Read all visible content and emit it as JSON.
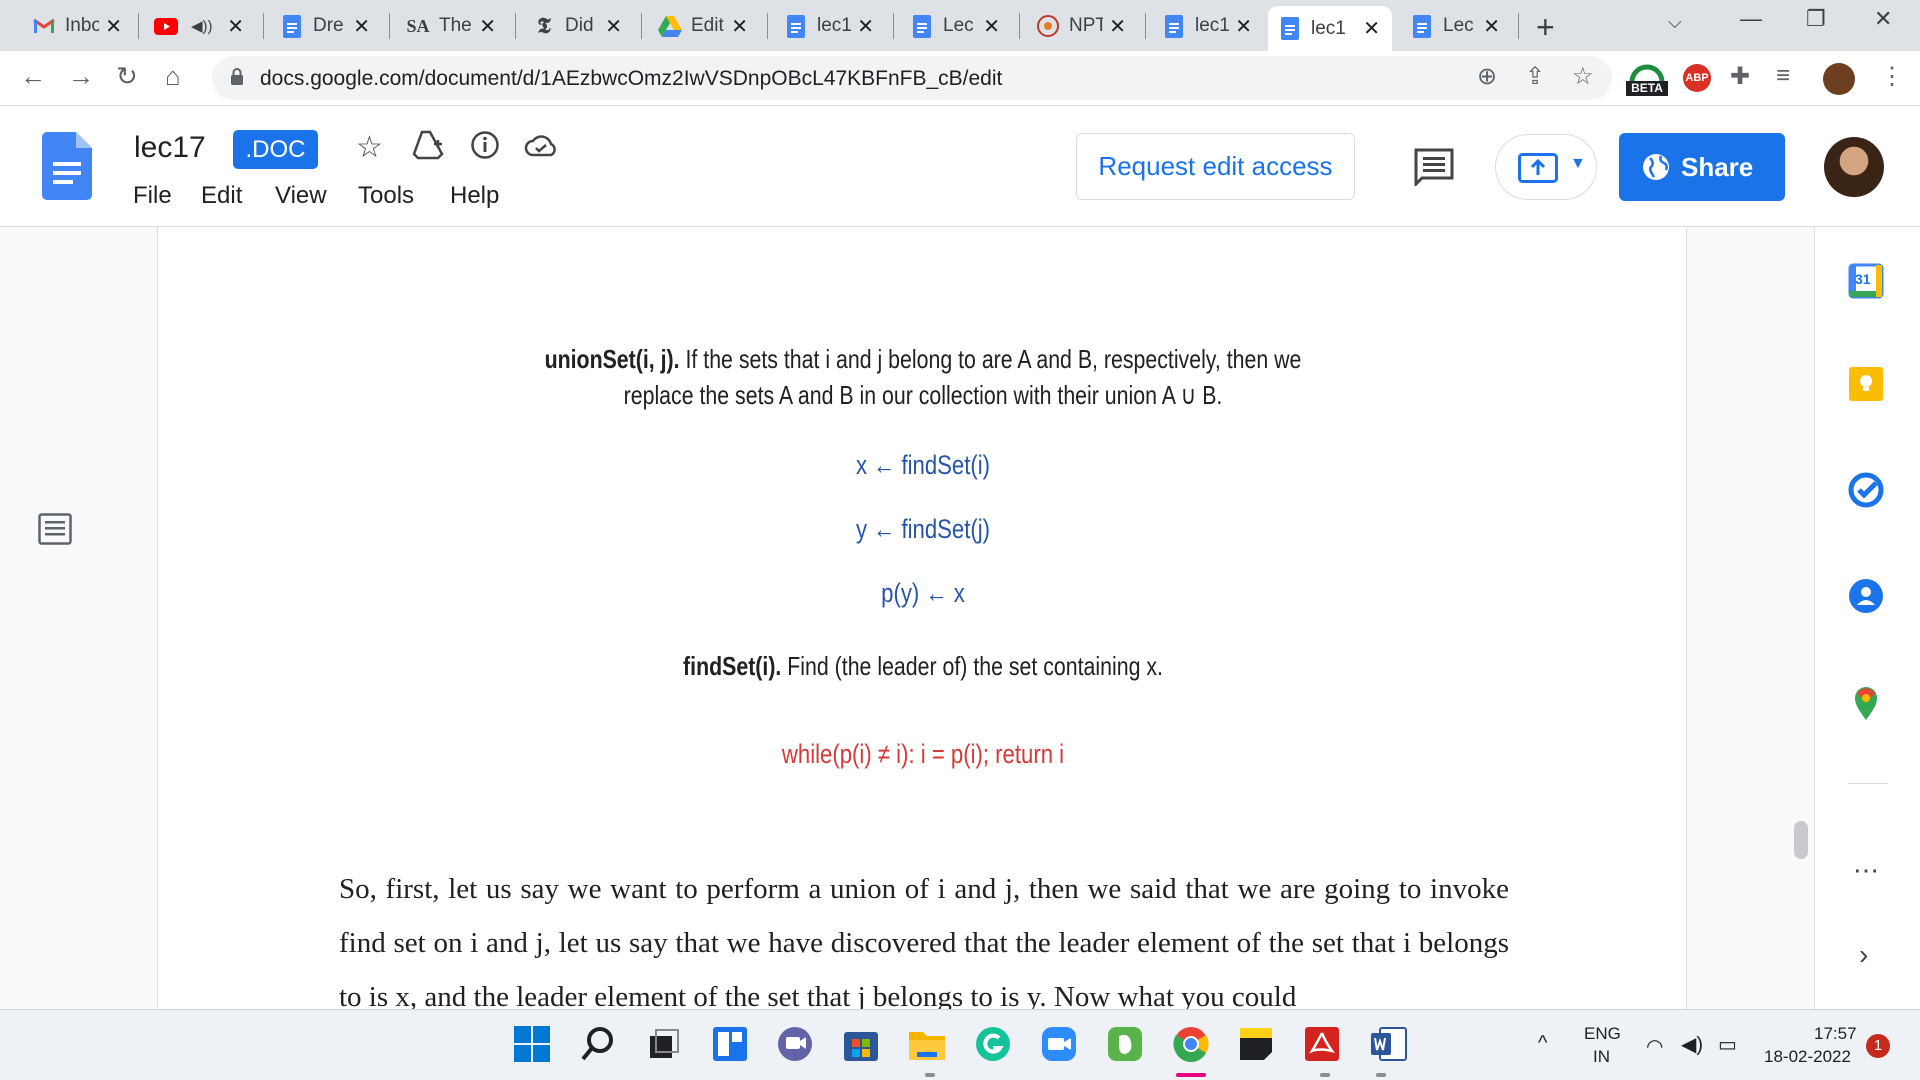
{
  "browser": {
    "tabs": [
      {
        "label": "Inbo",
        "icon": "gmail-icon",
        "active": false
      },
      {
        "label": "",
        "icon": "youtube-icon",
        "audio": true,
        "active": false
      },
      {
        "label": "Dre",
        "icon": "docs-icon",
        "active": false
      },
      {
        "label": "The",
        "icon": "sa-icon",
        "active": false
      },
      {
        "label": "Did",
        "icon": "nyt-icon",
        "active": false
      },
      {
        "label": "Edit",
        "icon": "drive-icon",
        "active": false
      },
      {
        "label": "lec1",
        "icon": "docs-icon",
        "active": false
      },
      {
        "label": "Lec",
        "icon": "docs-icon",
        "active": false
      },
      {
        "label": "NPT",
        "icon": "nptel-icon",
        "active": false
      },
      {
        "label": "lec1",
        "icon": "docs-icon",
        "active": false
      },
      {
        "label": "lec1",
        "icon": "docs-icon",
        "active": true
      },
      {
        "label": "Lec",
        "icon": "docs-icon",
        "active": false
      }
    ],
    "url": "docs.google.com/document/d/1AEzbwcOmz2IwVSDnpOBcL47KBFnFB_cB/edit",
    "beta_badge": "BETA",
    "abp_badge": "ABP"
  },
  "docs": {
    "title": "lec17",
    "badge": ".DOC",
    "menu": [
      "File",
      "Edit",
      "View",
      "Tools",
      "Help"
    ],
    "request_edit_label": "Request edit access",
    "share_label": "Share"
  },
  "content": {
    "union_bold": "unionSet(i, j).",
    "union_text_1": " If the sets that i and j belong to are A and B, respectively, then we",
    "union_text_2": "replace the sets A and B in our collection with their union A ∪ B.",
    "code_1": "x ← findSet(i)",
    "code_2": "y ← findSet(j)",
    "code_3": "p(y) ← x",
    "find_bold": "findSet(i).",
    "find_text": " Find (the leader of) the set containing x.",
    "while_code": "while(p(i) ≠ i): i = p(i); return i",
    "paragraph": "So, first, let us say we want to perform a union of i and j, then we said that we are going to invoke find set on i and j, let us say that we have discovered that the leader element of the set that i belongs to is x, and the leader element of the set that j belongs to is y. Now what you could"
  },
  "sidepanel": {
    "calendar_day": "31"
  },
  "taskbar": {
    "lang": "ENG",
    "region": "IN",
    "time": "17:57",
    "date": "18-02-2022",
    "notifications": "1"
  },
  "colors": {
    "accent": "#1a73e8",
    "slide_blue": "#2754a6",
    "slide_red": "#d33a3a"
  }
}
